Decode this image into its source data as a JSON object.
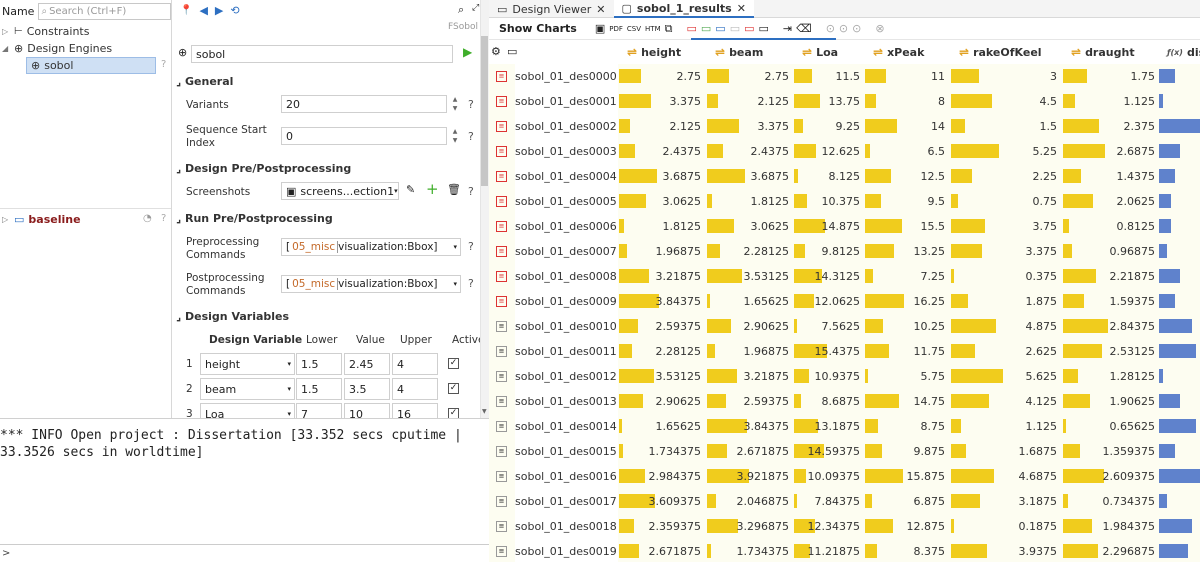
{
  "tree": {
    "name_label": "Name",
    "search_placeholder": "Search (Ctrl+F)",
    "items": [
      {
        "label": "Constraints"
      },
      {
        "label": "Design Engines"
      },
      {
        "label": "sobol"
      }
    ],
    "baseline": "baseline"
  },
  "props": {
    "engine_label": "FSobol",
    "name_value": "sobol",
    "sections": {
      "general": "General",
      "design_prepost": "Design Pre/Postprocessing",
      "run_prepost": "Run Pre/Postprocessing",
      "design_variables": "Design Variables"
    },
    "variants_label": "Variants",
    "variants_value": "20",
    "seq_start_label_1": "Sequence Start",
    "seq_start_label_2": "Index",
    "seq_start_value": "0",
    "screenshots_label": "Screenshots",
    "screenshots_value": "screens...ection1",
    "preproc_label_1": "Preprocessing",
    "preproc_label_2": "Commands",
    "preproc_bracket": "[",
    "preproc_misc": "05_misc",
    "preproc_value": "visualization:Bbox]",
    "postproc_label_1": "Postprocessing",
    "postproc_label_2": "Commands",
    "postproc_bracket": "[",
    "postproc_misc": "05_misc",
    "postproc_value": "visualization:Bbox]",
    "help": "?",
    "dv_headers": {
      "name": "Design Variable",
      "lower": "Lower",
      "value": "Value",
      "upper": "Upper",
      "active": "Active"
    },
    "design_variables": [
      {
        "idx": "1",
        "name": "height",
        "lower": "1.5",
        "value": "2.45",
        "upper": "4"
      },
      {
        "idx": "2",
        "name": "beam",
        "lower": "1.5",
        "value": "3.5",
        "upper": "4"
      },
      {
        "idx": "3",
        "name": "Loa",
        "lower": "7",
        "value": "10",
        "upper": "16"
      }
    ]
  },
  "console": {
    "line1": "*** INFO Open project : Dissertation [33.352 secs cputime |",
    "line2": "33.3526 secs in worldtime]",
    "prompt": ">"
  },
  "tabs": [
    {
      "label": "Design Viewer"
    },
    {
      "label": "sobol_1_results"
    }
  ],
  "toolbar": {
    "show_charts": "Show Charts",
    "pdf": "PDF",
    "csv": "CSV",
    "htm": "HTM"
  },
  "columns": [
    "height",
    "beam",
    "Loa",
    "xPeak",
    "rakeOfKeel",
    "draught",
    "disp"
  ],
  "column_ranges": {
    "height": [
      1.5,
      4
    ],
    "beam": [
      1.5,
      4
    ],
    "Loa": [
      7,
      16
    ],
    "xPeak": [
      5,
      17
    ],
    "rakeOfKeel": [
      0,
      6
    ],
    "draught": [
      0.5,
      3
    ]
  },
  "disp_fractions": [
    0.4,
    0.1,
    1.0,
    0.5,
    0.4,
    0.3,
    0.3,
    0.2,
    0.5,
    0.4,
    0.8,
    0.9,
    0.1,
    0.5,
    0.9,
    0.4,
    1.0,
    0.2,
    0.8,
    0.7
  ],
  "rows": [
    {
      "name": "sobol_01_des0000",
      "height": "2.75",
      "beam": "2.75",
      "Loa": "11.5",
      "xPeak": "11",
      "rakeOfKeel": "3",
      "draught": "1.75"
    },
    {
      "name": "sobol_01_des0001",
      "height": "3.375",
      "beam": "2.125",
      "Loa": "13.75",
      "xPeak": "8",
      "rakeOfKeel": "4.5",
      "draught": "1.125"
    },
    {
      "name": "sobol_01_des0002",
      "height": "2.125",
      "beam": "3.375",
      "Loa": "9.25",
      "xPeak": "14",
      "rakeOfKeel": "1.5",
      "draught": "2.375"
    },
    {
      "name": "sobol_01_des0003",
      "height": "2.4375",
      "beam": "2.4375",
      "Loa": "12.625",
      "xPeak": "6.5",
      "rakeOfKeel": "5.25",
      "draught": "2.6875"
    },
    {
      "name": "sobol_01_des0004",
      "height": "3.6875",
      "beam": "3.6875",
      "Loa": "8.125",
      "xPeak": "12.5",
      "rakeOfKeel": "2.25",
      "draught": "1.4375"
    },
    {
      "name": "sobol_01_des0005",
      "height": "3.0625",
      "beam": "1.8125",
      "Loa": "10.375",
      "xPeak": "9.5",
      "rakeOfKeel": "0.75",
      "draught": "2.0625"
    },
    {
      "name": "sobol_01_des0006",
      "height": "1.8125",
      "beam": "3.0625",
      "Loa": "14.875",
      "xPeak": "15.5",
      "rakeOfKeel": "3.75",
      "draught": "0.8125"
    },
    {
      "name": "sobol_01_des0007",
      "height": "1.96875",
      "beam": "2.28125",
      "Loa": "9.8125",
      "xPeak": "13.25",
      "rakeOfKeel": "3.375",
      "draught": "0.96875"
    },
    {
      "name": "sobol_01_des0008",
      "height": "3.21875",
      "beam": "3.53125",
      "Loa": "14.3125",
      "xPeak": "7.25",
      "rakeOfKeel": "0.375",
      "draught": "2.21875"
    },
    {
      "name": "sobol_01_des0009",
      "height": "3.84375",
      "beam": "1.65625",
      "Loa": "12.0625",
      "xPeak": "16.25",
      "rakeOfKeel": "1.875",
      "draught": "1.59375"
    },
    {
      "name": "sobol_01_des0010",
      "height": "2.59375",
      "beam": "2.90625",
      "Loa": "7.5625",
      "xPeak": "10.25",
      "rakeOfKeel": "4.875",
      "draught": "2.84375"
    },
    {
      "name": "sobol_01_des0011",
      "height": "2.28125",
      "beam": "1.96875",
      "Loa": "15.4375",
      "xPeak": "11.75",
      "rakeOfKeel": "2.625",
      "draught": "2.53125"
    },
    {
      "name": "sobol_01_des0012",
      "height": "3.53125",
      "beam": "3.21875",
      "Loa": "10.9375",
      "xPeak": "5.75",
      "rakeOfKeel": "5.625",
      "draught": "1.28125"
    },
    {
      "name": "sobol_01_des0013",
      "height": "2.90625",
      "beam": "2.59375",
      "Loa": "8.6875",
      "xPeak": "14.75",
      "rakeOfKeel": "4.125",
      "draught": "1.90625"
    },
    {
      "name": "sobol_01_des0014",
      "height": "1.65625",
      "beam": "3.84375",
      "Loa": "13.1875",
      "xPeak": "8.75",
      "rakeOfKeel": "1.125",
      "draught": "0.65625"
    },
    {
      "name": "sobol_01_des0015",
      "height": "1.734375",
      "beam": "2.671875",
      "Loa": "14.59375",
      "xPeak": "9.875",
      "rakeOfKeel": "1.6875",
      "draught": "1.359375"
    },
    {
      "name": "sobol_01_des0016",
      "height": "2.984375",
      "beam": "3.921875",
      "Loa": "10.09375",
      "xPeak": "15.875",
      "rakeOfKeel": "4.6875",
      "draught": "2.609375"
    },
    {
      "name": "sobol_01_des0017",
      "height": "3.609375",
      "beam": "2.046875",
      "Loa": "7.84375",
      "xPeak": "6.875",
      "rakeOfKeel": "3.1875",
      "draught": "0.734375"
    },
    {
      "name": "sobol_01_des0018",
      "height": "2.359375",
      "beam": "3.296875",
      "Loa": "12.34375",
      "xPeak": "12.875",
      "rakeOfKeel": "0.1875",
      "draught": "1.984375"
    },
    {
      "name": "sobol_01_des0019",
      "height": "2.671875",
      "beam": "1.734375",
      "Loa": "11.21875",
      "xPeak": "8.375",
      "rakeOfKeel": "3.9375",
      "draught": "2.296875"
    }
  ],
  "colors": {
    "bar": "#f0cc1d",
    "disp_bar": "#5f82cc",
    "accent": "#2d6fc1",
    "run_icon": "#3fae2a"
  }
}
